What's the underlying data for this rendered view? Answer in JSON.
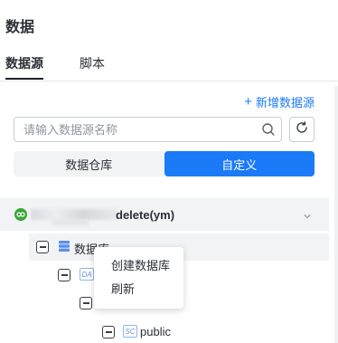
{
  "panel": {
    "title": "数据"
  },
  "tabs": [
    {
      "label": "数据源",
      "active": true
    },
    {
      "label": "脚本",
      "active": false
    }
  ],
  "add_datasource": {
    "plus": "+",
    "label": "新增数据源"
  },
  "search": {
    "placeholder": "请输入数据源名称",
    "value": ""
  },
  "segmented": [
    {
      "label": "数据仓库",
      "active": false
    },
    {
      "label": "自定义",
      "active": true
    }
  ],
  "tree": {
    "connection": {
      "label_visible": "delete(ym)",
      "icon": "link-icon",
      "icon_color": "#3aa635"
    },
    "database_node": {
      "label": "数据库"
    },
    "db_tag": "DA",
    "schema_tag": "SC",
    "schema": {
      "label": "public"
    }
  },
  "context_menu": {
    "items": [
      {
        "label": "创建数据库"
      },
      {
        "label": "刷新"
      }
    ]
  },
  "colors": {
    "accent": "#1a7af8",
    "text": "#2b2f36",
    "border": "#c9cdd4"
  }
}
